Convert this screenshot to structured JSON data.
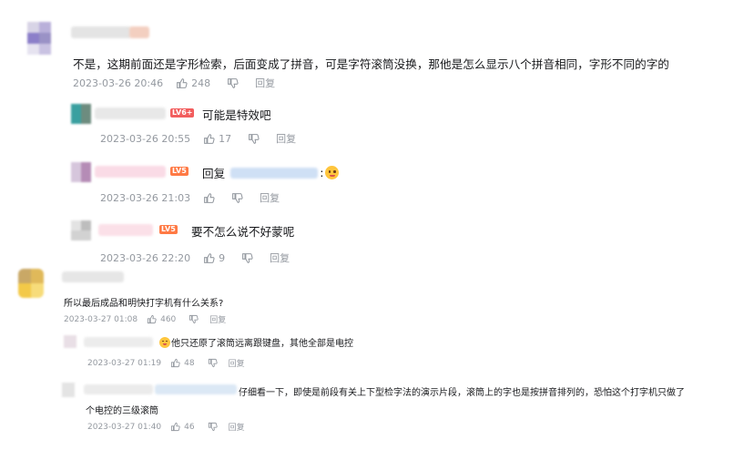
{
  "comments": [
    {
      "text": "不是，这期前面还是字形检索，后面变成了拼音，可是字符滚筒没换，那他是怎么显示八个拼音相同，字形不同的字的",
      "time": "2023-03-26 20:46",
      "likes": "248",
      "reply_label": "回复",
      "replies": [
        {
          "level": "LV6+",
          "text": "可能是特效吧",
          "time": "2023-03-26 20:55",
          "likes": "17",
          "reply_label": "回复"
        },
        {
          "level": "LV5",
          "text_prefix": "回复",
          "text_suffix": ":",
          "time": "2023-03-26 21:03",
          "likes": "",
          "reply_label": "回复"
        },
        {
          "level": "LV5",
          "text": "要不怎么说不好蒙呢",
          "time": "2023-03-26 22:20",
          "likes": "9",
          "reply_label": "回复"
        }
      ]
    },
    {
      "text": "所以最后成品和明快打字机有什么关系?",
      "time": "2023-03-27 01:08",
      "likes": "460",
      "reply_label": "回复",
      "replies": [
        {
          "text": "他只还原了滚筒远离跟键盘，其他全部是电控",
          "time": "2023-03-27 01:19",
          "likes": "48",
          "reply_label": "回复"
        },
        {
          "text_line1": "仔细看一下，即使是前段有关上下型检字法的演示片段，滚筒上的字也是按拼音排列的，恐怕这个打字机只做了",
          "text_line2": "个电控的三级滚筒",
          "time": "2023-03-27 01:40",
          "likes": "46",
          "reply_label": "回复"
        }
      ]
    }
  ],
  "icons": {
    "like": "thumbs-up-icon",
    "dislike": "thumbs-down-icon",
    "emoji": "smiley-emoji-icon"
  },
  "colors": {
    "meta": "#9499a0",
    "text": "#18191c",
    "level_red": "#f25d5d",
    "level_orange": "#ff7a45"
  }
}
